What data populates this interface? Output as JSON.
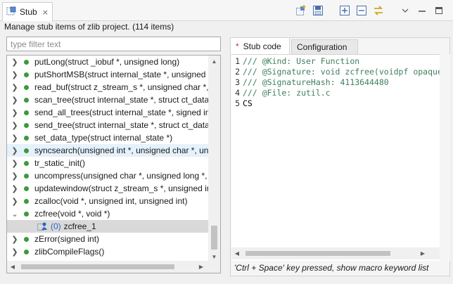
{
  "view": {
    "tab_title": "Stub",
    "close_glyph": "⨯",
    "tab_icon": "stub-view-icon",
    "toolbar_icons": [
      "new-stub-icon",
      "save-icon",
      "expand-all-icon",
      "collapse-all-icon",
      "sync-link-icon",
      "view-menu-icon",
      "minimize-icon",
      "maximize-icon"
    ]
  },
  "summary": "Manage stub items of zlib project. (114 items)",
  "filter": {
    "placeholder": "type filter text",
    "value": ""
  },
  "tree": {
    "items": [
      {
        "label": "putLong(struct _iobuf *, unsigned long)"
      },
      {
        "label": "putShortMSB(struct internal_state *, unsigned int)"
      },
      {
        "label": "read_buf(struct z_stream_s *, unsigned char *, unsigned)"
      },
      {
        "label": "scan_tree(struct internal_state *, struct ct_data_s *, int)"
      },
      {
        "label": "send_all_trees(struct internal_state *, signed int, int)"
      },
      {
        "label": "send_tree(struct internal_state *, struct ct_data_s *, int)"
      },
      {
        "label": "set_data_type(struct internal_state *)"
      },
      {
        "label": "syncsearch(unsigned int *, unsigned char *, unsigned)"
      },
      {
        "label": "tr_static_init()"
      },
      {
        "label": "uncompress(unsigned char *, unsigned long *, const)"
      },
      {
        "label": "updatewindow(struct z_stream_s *, unsigned int)"
      },
      {
        "label": "zcalloc(void *, unsigned int, unsigned int)"
      },
      {
        "label": "zcfree(void *, void *)"
      },
      {
        "label": "zError(signed int)"
      },
      {
        "label": "zlibCompileFlags()"
      }
    ],
    "child": {
      "count": "(0)",
      "label": "zcfree_1"
    }
  },
  "editor": {
    "tabs": {
      "active_marker": "*",
      "active": "Stub code",
      "inactive": "Configuration"
    },
    "lines": [
      {
        "num": "1",
        "text": "/// @Kind: User Function"
      },
      {
        "num": "2",
        "text": "/// @Signature: void  zcfree(voidpf opaque, voidpf ptr)"
      },
      {
        "num": "3",
        "text": "/// @SignatureHash: 4113644480"
      },
      {
        "num": "4",
        "text": "/// @File: zutil.c"
      },
      {
        "num": "5",
        "text": "CS"
      }
    ],
    "status": "'Ctrl + Space' key pressed, show macro keyword list"
  },
  "colors": {
    "accent_blue": "#2d66c4",
    "item_green": "#3c9a3c",
    "comment_green": "#3f7f5f",
    "dirty_red": "#d32f2f",
    "selection": "#d9d9d9",
    "hover": "#e5f1fb"
  }
}
